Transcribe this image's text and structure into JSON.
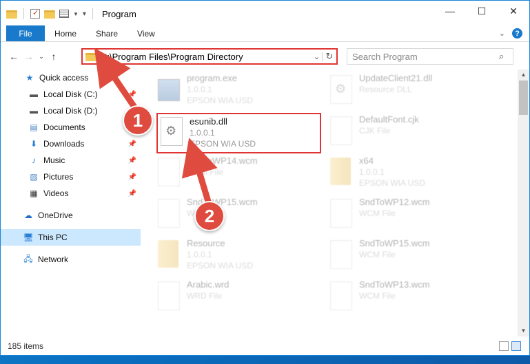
{
  "window": {
    "title": "Program",
    "controls": [
      "minimize",
      "maximize",
      "close"
    ]
  },
  "ribbon": {
    "file_tab": "File",
    "tabs": [
      "Home",
      "Share",
      "View"
    ]
  },
  "address": {
    "path": "C:\\Program Files\\Program Directory"
  },
  "search": {
    "placeholder": "Search Program"
  },
  "nav": {
    "items": [
      {
        "label": "Quick access",
        "icon": "star-icon",
        "pinned": false
      },
      {
        "label": "Local Disk (C:)",
        "icon": "drive-icon",
        "pinned": true
      },
      {
        "label": "Local Disk (D:)",
        "icon": "drive-icon",
        "pinned": true
      },
      {
        "label": "Documents",
        "icon": "documents-icon",
        "pinned": true
      },
      {
        "label": "Downloads",
        "icon": "download-icon",
        "pinned": true
      },
      {
        "label": "Music",
        "icon": "music-icon",
        "pinned": true
      },
      {
        "label": "Pictures",
        "icon": "pictures-icon",
        "pinned": true
      },
      {
        "label": "Videos",
        "icon": "videos-icon",
        "pinned": true
      },
      {
        "label": "OneDrive",
        "icon": "cloud-icon",
        "pinned": false
      },
      {
        "label": "This PC",
        "icon": "pc-icon",
        "pinned": false
      },
      {
        "label": "Network",
        "icon": "network-icon",
        "pinned": false
      }
    ]
  },
  "files": [
    {
      "name": "program.exe",
      "line2": "1.0.0.1",
      "line3": "EPSON WIA USD"
    },
    {
      "name": "UpdateClient21.dll",
      "line2": "Resource DLL",
      "line3": ""
    },
    {
      "name": "esunib.dll",
      "line2": "1.0.0.1",
      "line3": "EPSON WIA USD"
    },
    {
      "name": "DefaultFont.cjk",
      "line2": "CJK File",
      "line3": ""
    },
    {
      "name": "SndToWP14.wcm",
      "line2": "WCM File",
      "line3": ""
    },
    {
      "name": "x64",
      "line2": "1.0.0.1",
      "line3": "EPSON WIA USD"
    },
    {
      "name": "SndToWP15.wcm",
      "line2": "WCM File",
      "line3": ""
    },
    {
      "name": "SndToWP12.wcm",
      "line2": "WCM File",
      "line3": ""
    },
    {
      "name": "Resource",
      "line2": "1.0.0.1",
      "line3": "EPSON WIA USD"
    },
    {
      "name": "SndToWP15.wcm",
      "line2": "WCM File",
      "line3": ""
    },
    {
      "name": "Arabic.wrd",
      "line2": "WRD File",
      "line3": ""
    },
    {
      "name": "SndToWP13.wcm",
      "line2": "WCM File",
      "line3": ""
    }
  ],
  "status": {
    "item_count": "185 items"
  },
  "annotations": {
    "callout_1": "1",
    "callout_2": "2",
    "color": "#e04b3f"
  },
  "colors": {
    "accent": "#1979ca",
    "highlight_border": "#e03434",
    "selection": "#cce8ff"
  }
}
